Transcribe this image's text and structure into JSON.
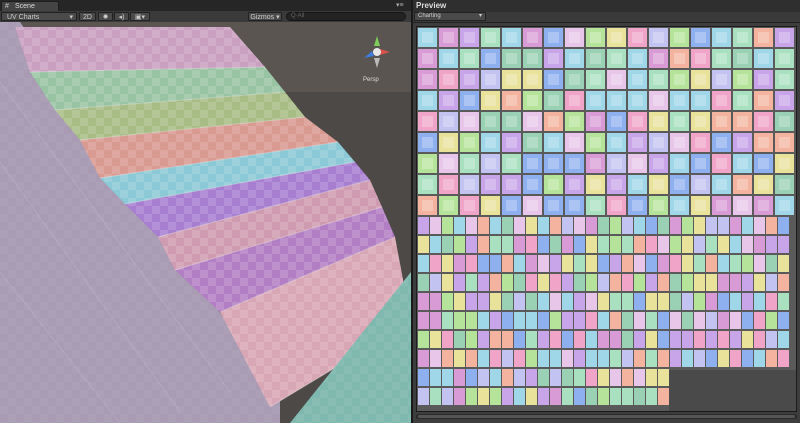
{
  "scene_panel": {
    "tab_label": "Scene",
    "tab_icon": "scene-grid-icon",
    "draw_mode": "UV Charts",
    "mode_2d": "2D",
    "gizmos_label": "Gizmos",
    "search_placeholder": "Q·All",
    "orientation_label": "Persp",
    "steps": [
      {
        "color": "#d8a7b5"
      },
      {
        "color": "#b37fc4"
      },
      {
        "color": "#cf9bb0"
      },
      {
        "color": "#a77ed0"
      },
      {
        "color": "#8cc9d6"
      },
      {
        "color": "#d99a92"
      },
      {
        "color": "#a8bd85"
      },
      {
        "color": "#98c4a3"
      },
      {
        "color": "#c9a0c0"
      }
    ]
  },
  "preview_panel": {
    "title": "Preview",
    "mode": "Charting",
    "mode_caret": "▾"
  }
}
